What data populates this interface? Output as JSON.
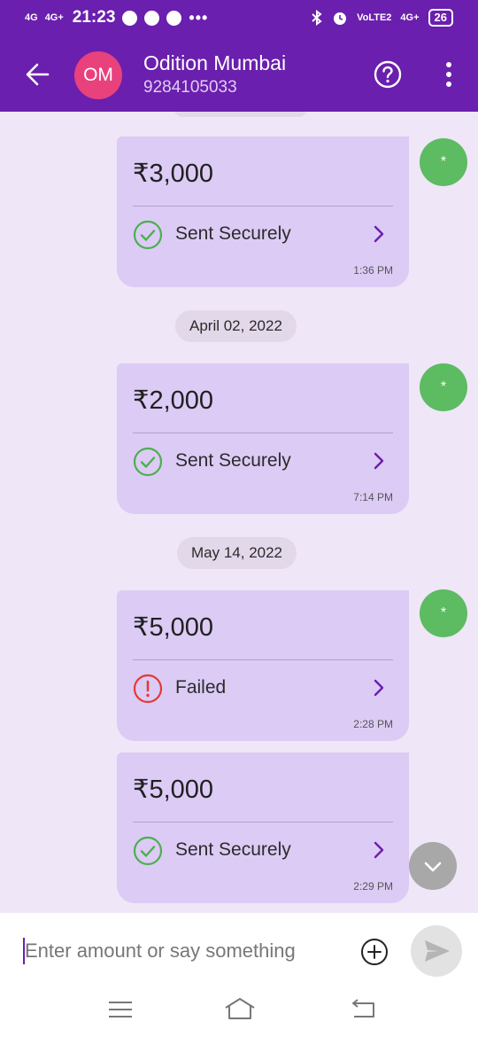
{
  "status_bar": {
    "net1": "4G",
    "net2": "4G+",
    "time": "21:23",
    "more": "•••",
    "volte": "VoLTE2",
    "net3": "4G+",
    "battery": "26"
  },
  "header": {
    "avatar_initials": "OM",
    "name": "Odition Mumbai",
    "phone": "9284105033"
  },
  "messages": [
    {
      "amount": "₹3,000",
      "status": "Sent Securely",
      "state": "success",
      "time": "1:36 PM",
      "avatar": "*"
    },
    {
      "amount": "₹2,000",
      "status": "Sent Securely",
      "state": "success",
      "time": "7:14 PM",
      "avatar": "*"
    },
    {
      "amount": "₹5,000",
      "status": "Failed",
      "state": "failed",
      "time": "2:28 PM",
      "avatar": "*"
    },
    {
      "amount": "₹5,000",
      "status": "Sent Securely",
      "state": "success",
      "time": "2:29 PM"
    }
  ],
  "dates": [
    "April 02, 2022",
    "May 14, 2022"
  ],
  "composer": {
    "placeholder": "Enter amount or say something"
  },
  "colors": {
    "brand": "#6a1fae",
    "bubble": "#dccbf5",
    "success": "#4caf50",
    "failed": "#e53935",
    "avatar_contact": "#e9417c",
    "avatar_sender": "#5dbb62"
  }
}
